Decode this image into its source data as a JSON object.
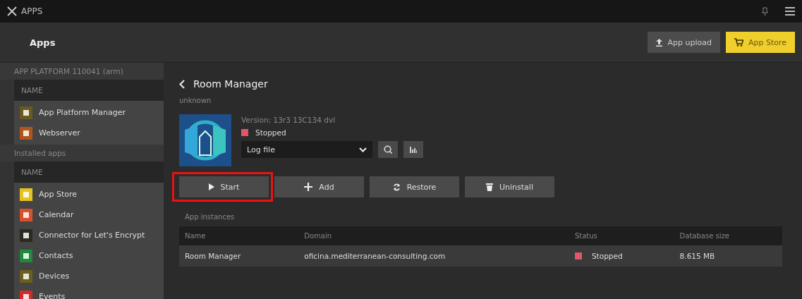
{
  "topbar": {
    "title": "APPS"
  },
  "header": {
    "title": "Apps",
    "buttons": [
      {
        "label": "App upload",
        "kind": "upload"
      },
      {
        "label": "App Store",
        "kind": "store"
      }
    ]
  },
  "sidebar": {
    "sections": [
      {
        "title": "APP PLATFORM 110041 (arm)",
        "column": "NAME",
        "items": [
          {
            "label": "App Platform Manager",
            "color": "#6b5a1e"
          },
          {
            "label": "Webserver",
            "color": "#b0561c"
          }
        ]
      },
      {
        "title": "Installed apps",
        "column": "NAME",
        "items": [
          {
            "label": "App Store",
            "color": "#e6c21e"
          },
          {
            "label": "Calendar",
            "color": "#d9512c"
          },
          {
            "label": "Connector for Let's Encrypt",
            "color": "#2a2a1e"
          },
          {
            "label": "Contacts",
            "color": "#1f8a3a"
          },
          {
            "label": "Devices",
            "color": "#6b5f1e"
          },
          {
            "label": "Events",
            "color": "#d02a2a"
          }
        ]
      }
    ]
  },
  "app": {
    "title": "Room Manager",
    "subtitle": "unknown",
    "version": "Version: 13r3 13C134 dvl",
    "status": {
      "label": "Stopped",
      "color": "#e0576a"
    },
    "log_select": {
      "value": "Log file"
    },
    "actions": [
      {
        "label": "Start",
        "kind": "start",
        "highlighted": true
      },
      {
        "label": "Add",
        "kind": "add",
        "highlighted": false
      },
      {
        "label": "Restore",
        "kind": "restore",
        "highlighted": false
      },
      {
        "label": "Uninstall",
        "kind": "uninstall",
        "highlighted": false
      }
    ]
  },
  "instances": {
    "title": "App instances",
    "columns": [
      "Name",
      "Domain",
      "Status",
      "Database size"
    ],
    "rows": [
      {
        "name": "Room Manager",
        "domain": "oficina.mediterranean-consulting.com",
        "status": "Stopped",
        "color": "#e0576a",
        "size": "8.615 MB"
      }
    ]
  }
}
